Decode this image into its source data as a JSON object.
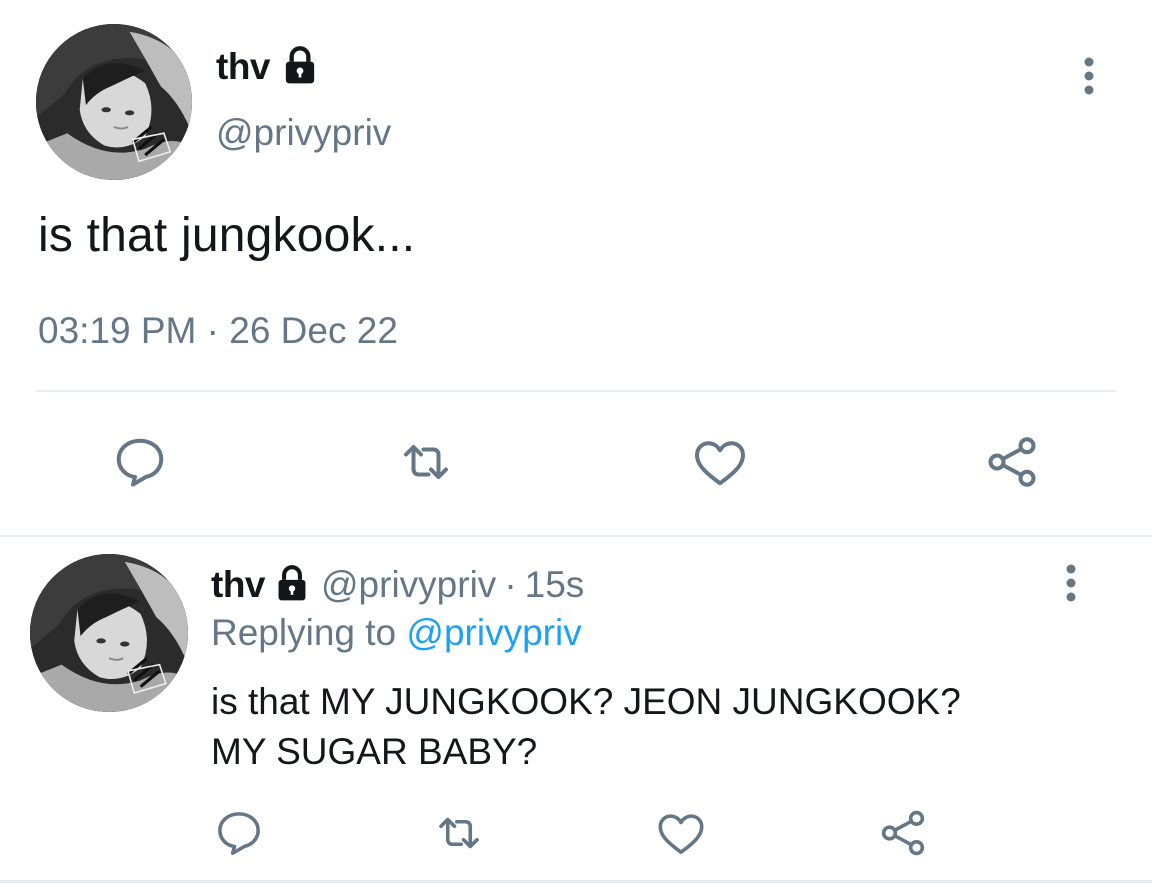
{
  "tweet": {
    "author_name": "thv",
    "author_handle": "@privypriv",
    "text": "is that jungkook...",
    "timestamp": "03:19 PM · 26 Dec 22",
    "locked": true
  },
  "reply": {
    "author_name": "thv",
    "author_handle": "@privypriv",
    "separator": "·",
    "time": "15s",
    "replying_label": "Replying to",
    "replying_to": "@privypriv",
    "text_line1": "is that MY JUNGKOOK? JEON JUNGKOOK?",
    "text_line2": "MY SUGAR BABY?",
    "locked": true
  },
  "icons": {
    "reply": "reply-icon",
    "retweet": "retweet-icon",
    "like": "heart-icon",
    "share": "share-icon",
    "more": "more-vertical-icon",
    "lock": "lock-icon"
  },
  "colors": {
    "text": "#14171a",
    "secondary": "#657786",
    "link": "#1da1f2",
    "divider": "#e6ecf0"
  }
}
